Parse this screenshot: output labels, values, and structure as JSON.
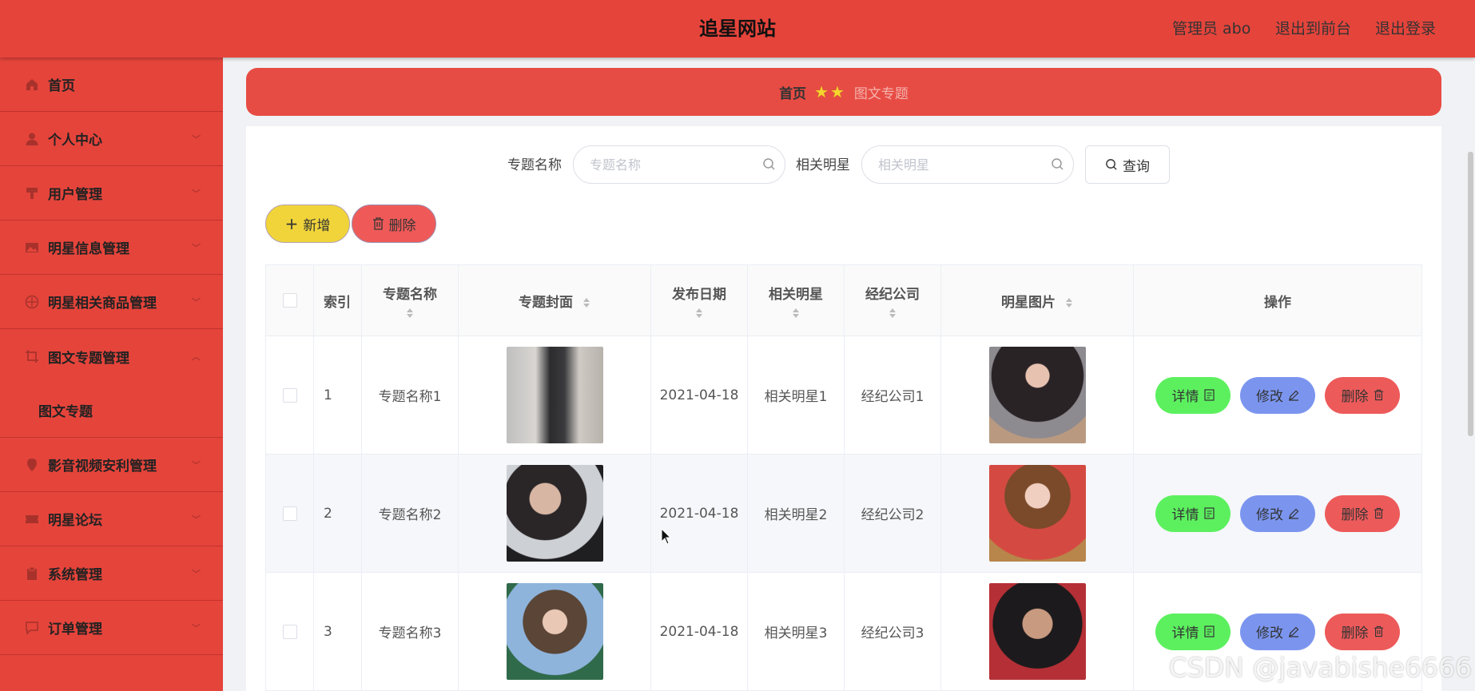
{
  "header": {
    "title": "追星网站",
    "admin_label": "管理员 abo",
    "to_front_label": "退出到前台",
    "logout_label": "退出登录"
  },
  "sidebar": {
    "items": [
      {
        "label": "首页",
        "icon": "home-icon"
      },
      {
        "label": "个人中心",
        "icon": "user-icon"
      },
      {
        "label": "用户管理",
        "icon": "users-icon"
      },
      {
        "label": "明星信息管理",
        "icon": "picture-icon"
      },
      {
        "label": "明星相关商品管理",
        "icon": "compass-icon"
      },
      {
        "label": "图文专题管理",
        "icon": "crop-icon",
        "expanded": true,
        "children": [
          {
            "label": "图文专题"
          }
        ]
      },
      {
        "label": "影音视频安利管理",
        "icon": "location-icon"
      },
      {
        "label": "明星论坛",
        "icon": "ticket-icon"
      },
      {
        "label": "系统管理",
        "icon": "clipboard-icon"
      },
      {
        "label": "订单管理",
        "icon": "chat-icon"
      }
    ]
  },
  "breadcrumb": {
    "home": "首页",
    "current": "图文专题",
    "separator": "★★"
  },
  "search": {
    "name_label": "专题名称",
    "name_placeholder": "专题名称",
    "star_label": "相关明星",
    "star_placeholder": "相关明星",
    "query_label": "查询"
  },
  "actions": {
    "add_label": "新增",
    "delete_label": "删除"
  },
  "table": {
    "columns": [
      "索引",
      "专题名称",
      "专题封面",
      "发布日期",
      "相关明星",
      "经纪公司",
      "明星图片",
      "操作"
    ],
    "rows": [
      {
        "index": "1",
        "name": "专题名称1",
        "date": "2021-04-18",
        "star": "相关明星1",
        "company": "经纪公司1"
      },
      {
        "index": "2",
        "name": "专题名称2",
        "date": "2021-04-18",
        "star": "相关明星2",
        "company": "经纪公司2"
      },
      {
        "index": "3",
        "name": "专题名称3",
        "date": "2021-04-18",
        "star": "相关明星3",
        "company": "经纪公司3"
      }
    ],
    "row_actions": {
      "detail": "详情",
      "edit": "修改",
      "delete": "删除"
    }
  },
  "watermark": "CSDN @javabishe6666",
  "colors": {
    "primary": "#e5443b",
    "detail_btn": "#5cf05f",
    "edit_btn": "#7b95ef",
    "delete_btn": "#ed5a5a",
    "add_btn": "#f0d43a"
  }
}
